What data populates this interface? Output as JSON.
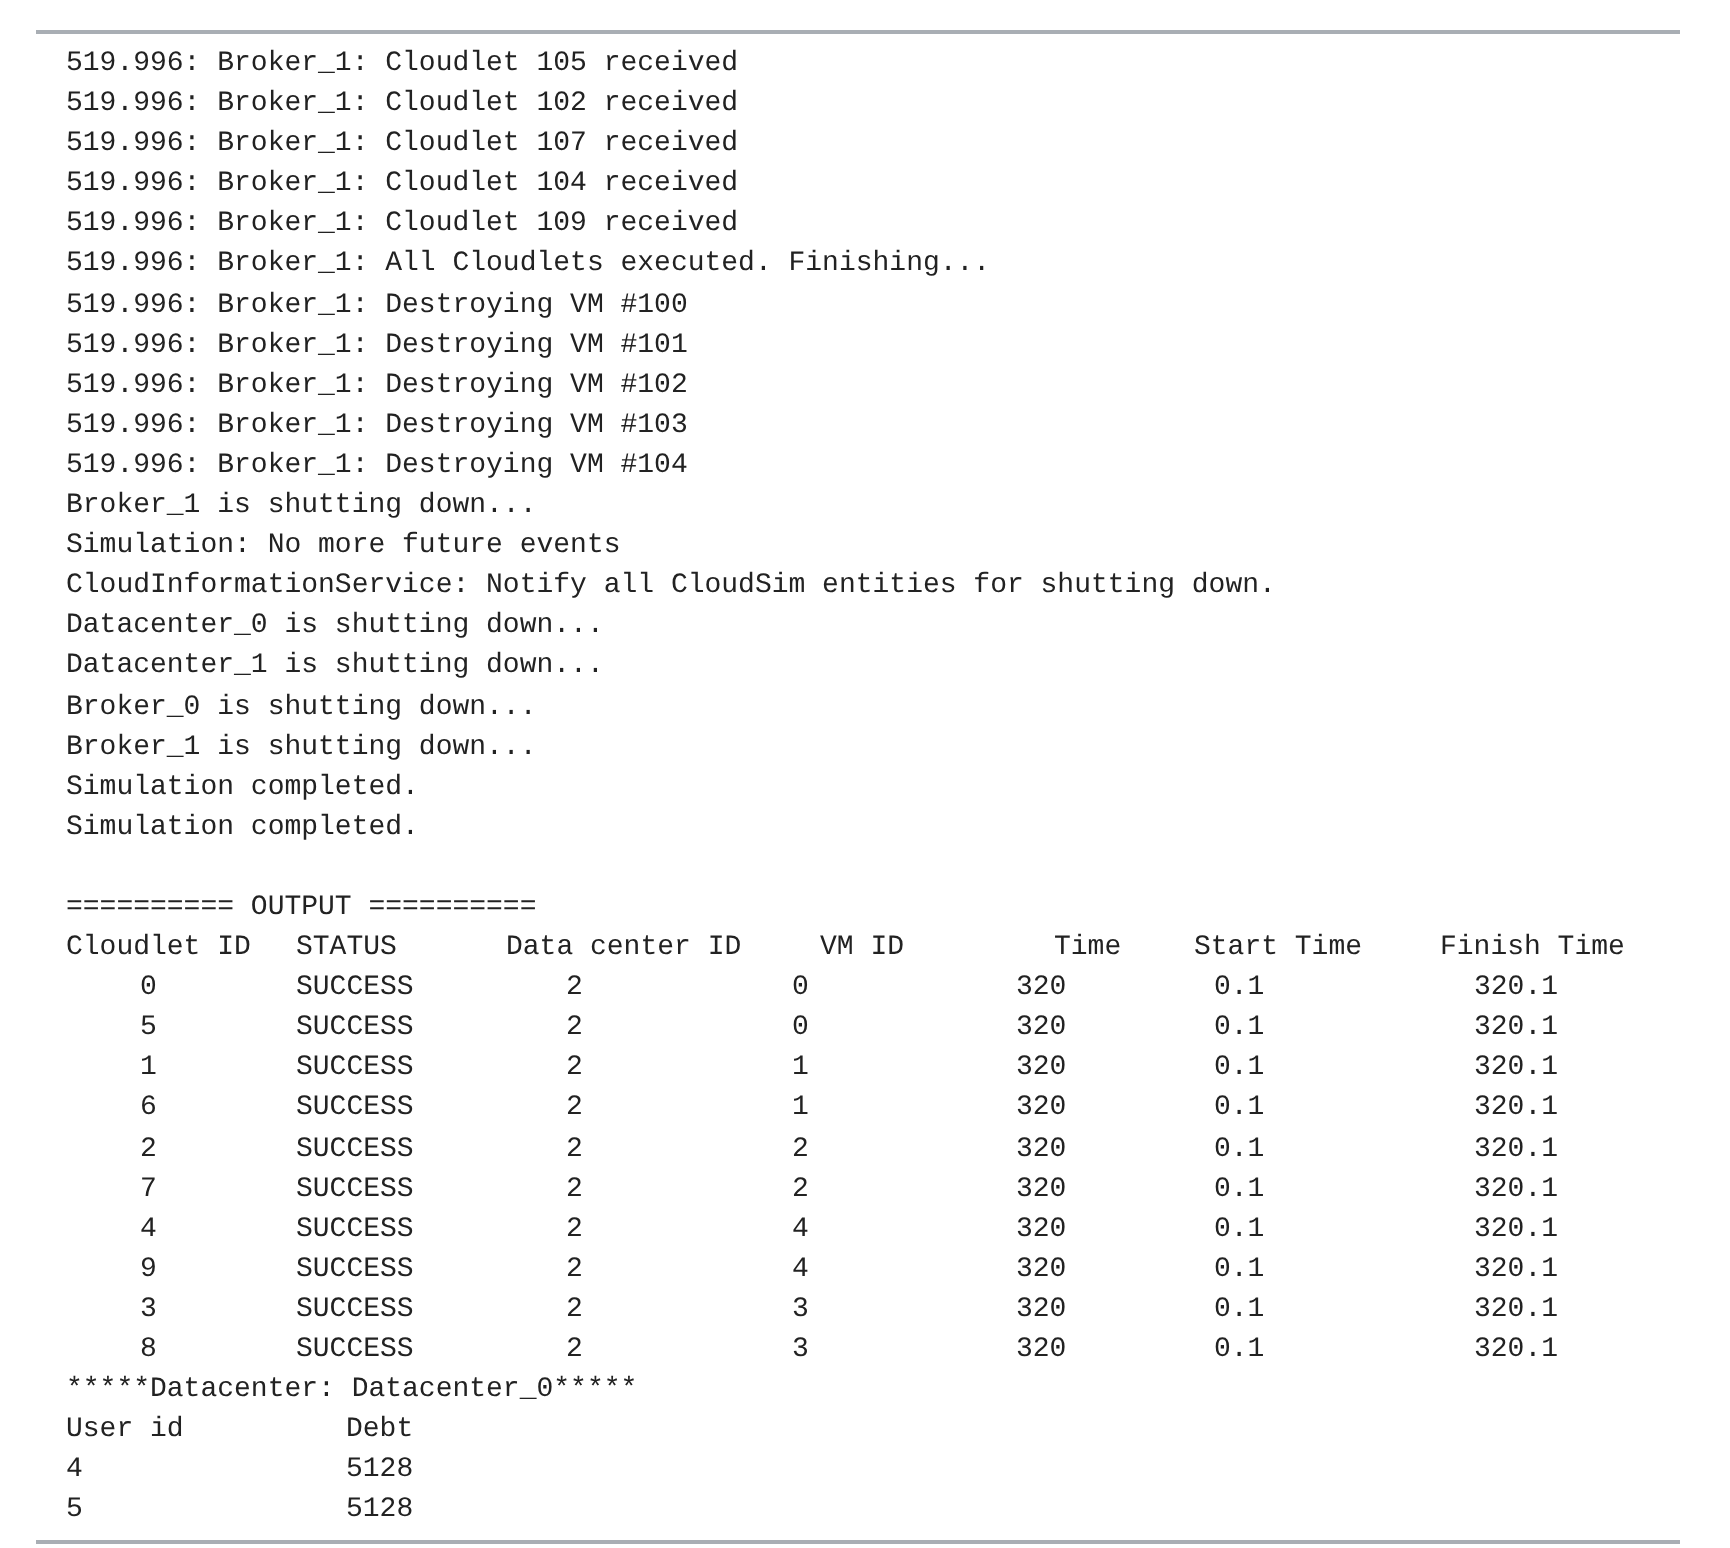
{
  "console": {
    "log_lines": [
      "519.996: Broker_1: Cloudlet 105 received",
      "519.996: Broker_1: Cloudlet 102 received",
      "519.996: Broker_1: Cloudlet 107 received",
      "519.996: Broker_1: Cloudlet 104 received",
      "519.996: Broker_1: Cloudlet 109 received",
      "519.996: Broker_1: All Cloudlets executed. Finishing...",
      "519.996: Broker_1: Destroying VM #100",
      "519.996: Broker_1: Destroying VM #101",
      "519.996: Broker_1: Destroying VM #102",
      "519.996: Broker_1: Destroying VM #103",
      "519.996: Broker_1: Destroying VM #104",
      "Broker_1 is shutting down...",
      "Simulation: No more future events",
      "CloudInformationService: Notify all CloudSim entities for shutting down.",
      "Datacenter_0 is shutting down...",
      "Datacenter_1 is shutting down...",
      "Broker_0 is shutting down...",
      "Broker_1 is shutting down...",
      "Simulation completed.",
      "Simulation completed."
    ],
    "output_heading": "========== OUTPUT ==========",
    "output_table": {
      "columns": [
        "Cloudlet ID",
        "STATUS",
        "Data center ID",
        "VM ID",
        "Time",
        "Start Time",
        "Finish Time"
      ],
      "rows": [
        [
          "0",
          "SUCCESS",
          "2",
          "0",
          "320",
          "0.1",
          "320.1"
        ],
        [
          "5",
          "SUCCESS",
          "2",
          "0",
          "320",
          "0.1",
          "320.1"
        ],
        [
          "1",
          "SUCCESS",
          "2",
          "1",
          "320",
          "0.1",
          "320.1"
        ],
        [
          "6",
          "SUCCESS",
          "2",
          "1",
          "320",
          "0.1",
          "320.1"
        ],
        [
          "2",
          "SUCCESS",
          "2",
          "2",
          "320",
          "0.1",
          "320.1"
        ],
        [
          "7",
          "SUCCESS",
          "2",
          "2",
          "320",
          "0.1",
          "320.1"
        ],
        [
          "4",
          "SUCCESS",
          "2",
          "4",
          "320",
          "0.1",
          "320.1"
        ],
        [
          "9",
          "SUCCESS",
          "2",
          "4",
          "320",
          "0.1",
          "320.1"
        ],
        [
          "3",
          "SUCCESS",
          "2",
          "3",
          "320",
          "0.1",
          "320.1"
        ],
        [
          "8",
          "SUCCESS",
          "2",
          "3",
          "320",
          "0.1",
          "320.1"
        ]
      ]
    },
    "datacenter_heading": "*****Datacenter: Datacenter_0*****",
    "debt_table": {
      "columns": [
        "User id",
        "Debt"
      ],
      "rows": [
        [
          "4",
          "5128"
        ],
        [
          "5",
          "5128"
        ]
      ]
    }
  }
}
